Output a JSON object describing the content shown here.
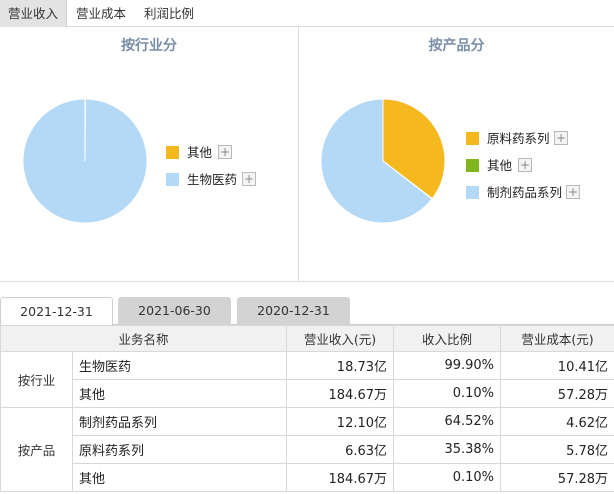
{
  "top_tabs": [
    "营业收入",
    "营业成本",
    "利润比例"
  ],
  "panels": {
    "industry": {
      "title": "按行业分",
      "legend": [
        {
          "label": "其他",
          "color": "#f5b81f"
        },
        {
          "label": "生物医药",
          "color": "#b3d9f7"
        }
      ]
    },
    "product": {
      "title": "按产品分",
      "legend": [
        {
          "label": "原料药系列",
          "color": "#f5b81f"
        },
        {
          "label": "其他",
          "color": "#7fb51d"
        },
        {
          "label": "制剂药品系列",
          "color": "#b3d9f7"
        }
      ]
    },
    "plus_symbol": "+"
  },
  "chart_data": [
    {
      "type": "pie",
      "title": "按行业分",
      "labels": [
        "其他",
        "生物医药"
      ],
      "values": [
        0.1,
        99.9
      ],
      "colors": [
        "#f5b81f",
        "#b3d9f7"
      ]
    },
    {
      "type": "pie",
      "title": "按产品分",
      "labels": [
        "原料药系列",
        "其他",
        "制剂药品系列"
      ],
      "values": [
        35.38,
        0.1,
        64.52
      ],
      "colors": [
        "#f5b81f",
        "#7fb51d",
        "#b3d9f7"
      ]
    }
  ],
  "date_tabs": [
    "2021-12-31",
    "2021-06-30",
    "2020-12-31"
  ],
  "table": {
    "headers": [
      "业务名称",
      "营业收入(元)",
      "收入比例",
      "营业成本(元)"
    ],
    "groups": [
      {
        "name": "按行业",
        "rows": [
          {
            "name": "生物医药",
            "revenue": "18.73亿",
            "ratio": "99.90%",
            "cost": "10.41亿"
          },
          {
            "name": "其他",
            "revenue": "184.67万",
            "ratio": "0.10%",
            "cost": "57.28万"
          }
        ]
      },
      {
        "name": "按产品",
        "rows": [
          {
            "name": "制剂药品系列",
            "revenue": "12.10亿",
            "ratio": "64.52%",
            "cost": "4.62亿"
          },
          {
            "name": "原料药系列",
            "revenue": "6.63亿",
            "ratio": "35.38%",
            "cost": "5.78亿"
          },
          {
            "name": "其他",
            "revenue": "184.67万",
            "ratio": "0.10%",
            "cost": "57.28万"
          }
        ]
      }
    ]
  }
}
